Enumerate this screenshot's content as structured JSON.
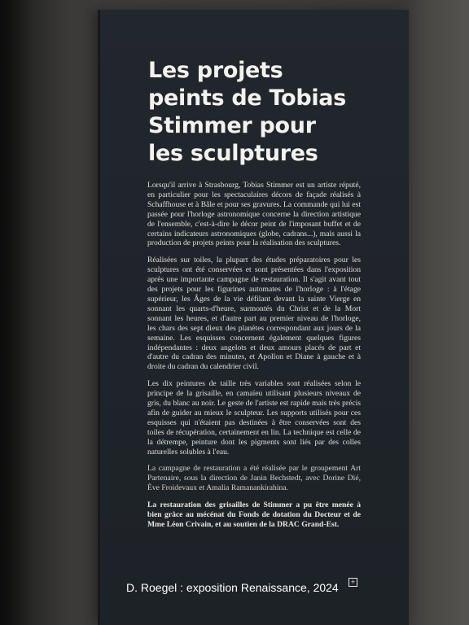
{
  "panel": {
    "title_lines": [
      "Les projets",
      "peints de Tobias",
      "Stimmer pour",
      "les sculptures"
    ],
    "paragraphs": [
      "Lorsqu'il arrive à Strasbourg, Tobias Stimmer est un artiste réputé, en particulier pour les spectaculaires décors de façade réalisés à Schaffhouse et à Bâle et pour ses gravures. La commande qui lui est passée pour l'horloge astronomique concerne la direction artistique de l'ensemble, c'est-à-dire le décor peint de l'imposant buffet et de certains indicateurs astronomiques (globe, cadrans...), mais aussi la production de projets peints pour la réalisation des sculptures.",
      "Réalisées sur toiles, la plupart des études préparatoires pour les sculptures ont été conservées et sont présentées dans l'exposition après une importante campagne de restauration. Il s'agit avant tout des projets pour les figurines automates de l'horloge : à l'étage supérieur, les Âges de la vie défilant devant la sainte Vierge en sonnant les quarts-d'heure, surmontés du Christ et de la Mort sonnant les heures, et d'autre part au premier niveau de l'horloge, les chars des sept dieux des planètes correspondant aux jours de la semaine. Les esquisses concernent également quelques figures indépendantes : deux angelots et deux amours placés de part et d'autre du cadran des minutes, et Apollon et Diane à gauche et à droite du cadran du calendrier civil.",
      "Les dix peintures de taille très variables sont réalisées selon le principe de la grisaille, en camaïeu utilisant plusieurs niveaux de gris, du blanc au noir. Le geste de l'artiste est rapide mais très précis afin de guider au mieux le sculpteur. Les supports utilisés pour ces esquisses qui n'étaient pas destinées à être conservées sont des toiles de récupération, certainement en lin. La technique est celle de la détrempe, peinture dont les pigments sont liés par des colles naturelles solubles à l'eau.",
      "La campagne de restauration a été réalisée par le groupement Art Partenaire, sous la direction de Janin Bechstedt, avec Dorine Dié, Ève Froidevaux et Amalia Ramanankirahina.",
      "La restauration des grisailles de Stimmer a pu être menée à bien grâce au mécénat du Fonds de dotation du Docteur et de Mme Léon Crivain, et au soutien de la DRAC Grand-Est."
    ]
  },
  "watermark": "D. Roegel : exposition Renaissance, 2024",
  "badge": "+",
  "colors": {
    "panel": "#21262b",
    "wall": "#3b3a38",
    "title": "#f4f2ee",
    "text": "#e2ded5"
  }
}
